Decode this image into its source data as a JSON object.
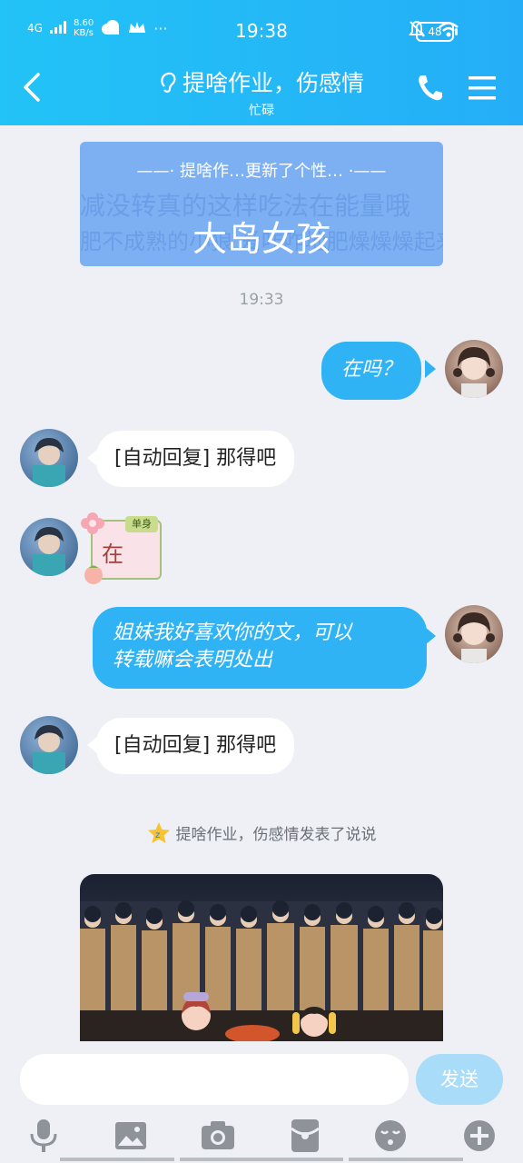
{
  "status_bar": {
    "network": "4G",
    "speed_value": "8.60",
    "speed_unit": "KB/s",
    "time": "19:38",
    "battery": "48"
  },
  "header": {
    "title": "提啥作业，伤感情",
    "subtitle": "忙碌"
  },
  "banner": {
    "headline": "——· 提啥作…更新了个性… ·——",
    "main_text": "大岛女孩",
    "bg_text_1": "减没转真的这样吃法在能量哦",
    "bg_text_2": "肥不成熟的小狼 爱咋咋地肥燥燥燥起来"
  },
  "messages": {
    "timestamp": "19:33",
    "m1": "在吗？",
    "m2": "[自动回复] 那得吧",
    "sticker_text": "在",
    "sticker_tag": "单身",
    "m3_line1": "姐妹我好喜欢你的文，可以",
    "m3_line2": "转载嘛会表明处出",
    "m4": "[自动回复] 那得吧"
  },
  "notice": {
    "text": "提啥作业，伤感情发表了说说"
  },
  "composer": {
    "input_value": "",
    "send_label": "发送"
  },
  "colors": {
    "header_start": "#22c3f7",
    "header_end": "#25aef7",
    "bubble_out": "#2fb3f4",
    "background": "#eef0f5"
  },
  "icons": [
    "back-arrow-icon",
    "ear-icon",
    "phone-icon",
    "menu-icon",
    "qzone-star-icon",
    "microphone-icon",
    "image-icon",
    "camera-icon",
    "red-packet-icon",
    "emoji-icon",
    "plus-icon"
  ]
}
